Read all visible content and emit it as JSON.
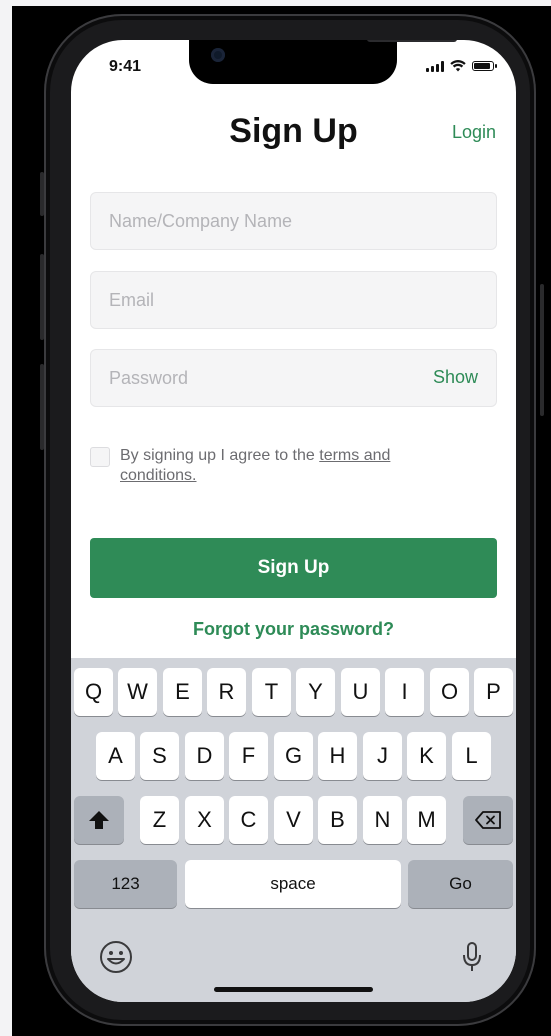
{
  "status": {
    "time": "9:41"
  },
  "header": {
    "title": "Sign Up",
    "login_label": "Login"
  },
  "form": {
    "name_placeholder": "Name/Company Name",
    "email_placeholder": "Email",
    "password_placeholder": "Password",
    "show_label": "Show",
    "terms_prefix": "By signing up I agree to the ",
    "terms_link": "terms and conditions.",
    "signup_label": "Sign Up",
    "forgot_label": "Forgot your password?"
  },
  "keyboard": {
    "row1": [
      "Q",
      "W",
      "E",
      "R",
      "T",
      "Y",
      "U",
      "I",
      "O",
      "P"
    ],
    "row2": [
      "A",
      "S",
      "D",
      "F",
      "G",
      "H",
      "J",
      "K",
      "L"
    ],
    "row3": [
      "Z",
      "X",
      "C",
      "V",
      "B",
      "N",
      "M"
    ],
    "numbers_label": "123",
    "space_label": "space",
    "go_label": "Go"
  },
  "colors": {
    "accent": "#2e8b57",
    "field_bg": "#f5f5f6",
    "keyboard_bg": "#d0d3d9"
  },
  "icons": [
    "shift-icon",
    "backspace-icon",
    "emoji-icon",
    "microphone-icon"
  ]
}
